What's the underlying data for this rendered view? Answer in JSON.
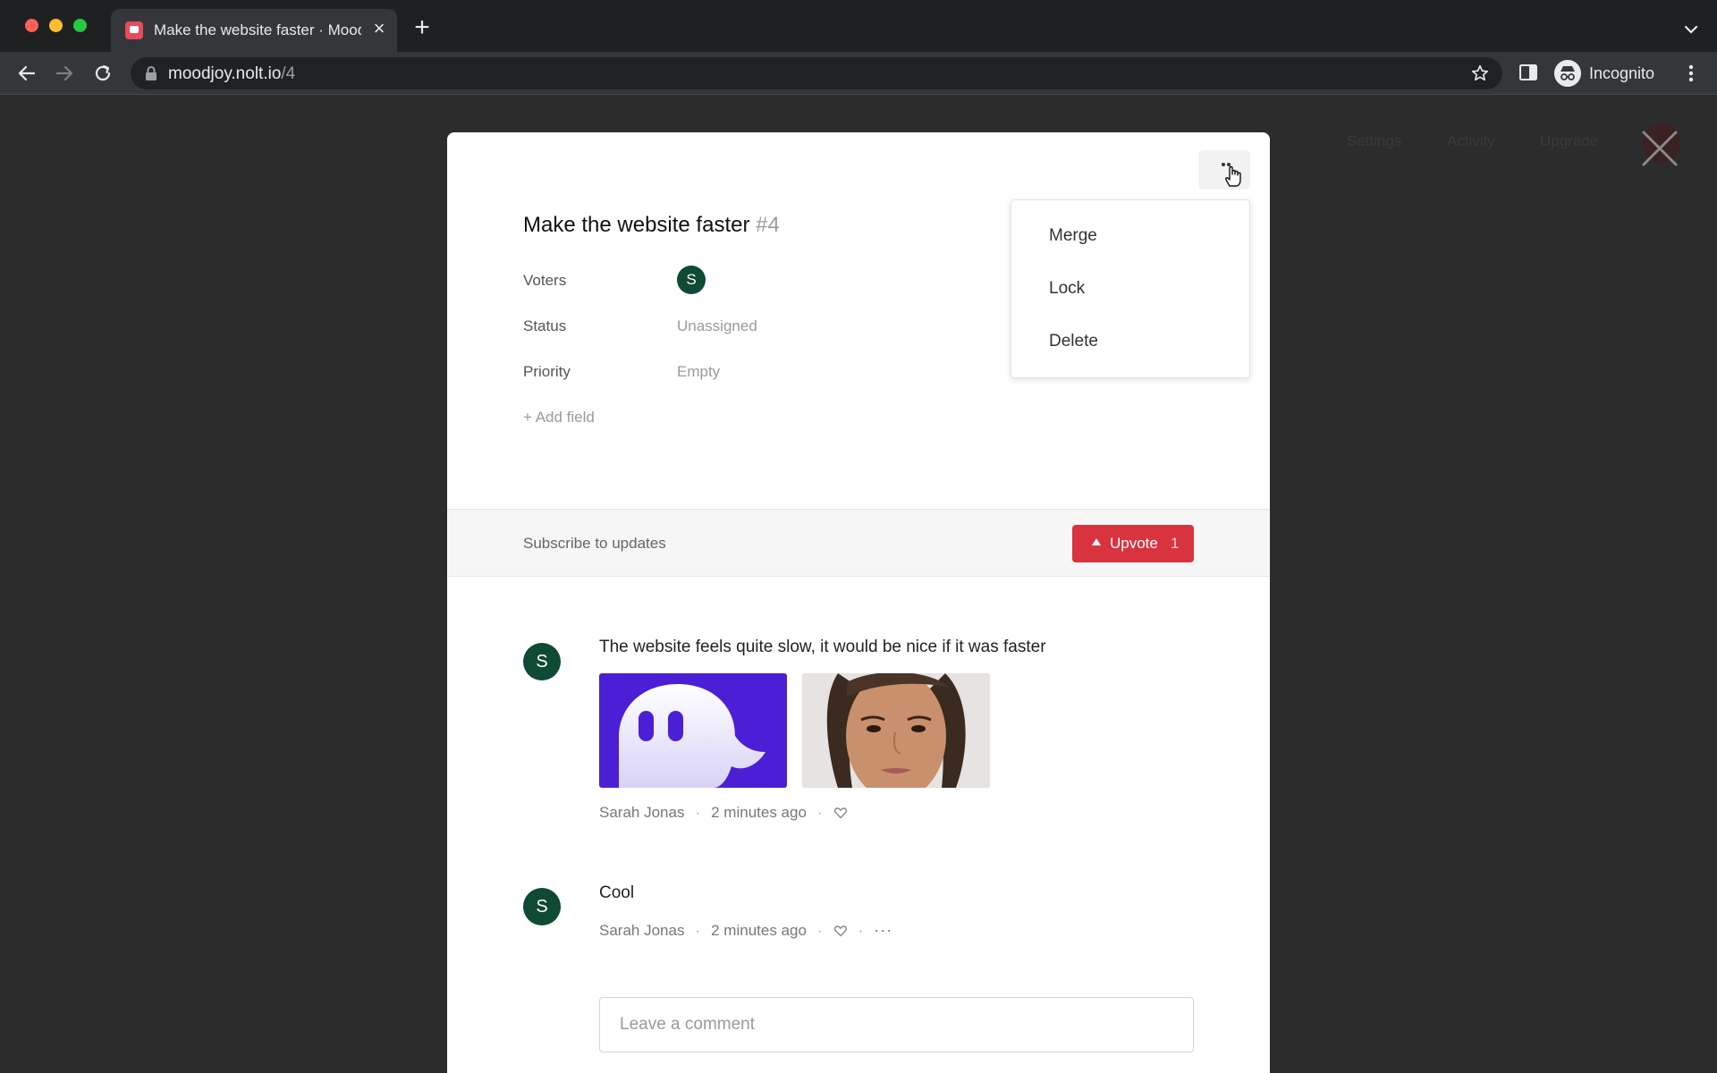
{
  "browser": {
    "tab_title": "Make the website faster · Moodjoy",
    "new_tab": "+",
    "tab_close": "×",
    "url_host": "moodjoy.nolt.io",
    "url_path": "/4",
    "profile_label": "Incognito"
  },
  "background_nav": {
    "settings": "Settings",
    "activity": "Activity",
    "upgrade": "Upgrade"
  },
  "post": {
    "title": "Make the website faster",
    "number": "#4",
    "fields": {
      "voters_label": "Voters",
      "voter_initial": "S",
      "status_label": "Status",
      "status_value": "Unassigned",
      "priority_label": "Priority",
      "priority_value": "Empty",
      "add_field": "+ Add field"
    }
  },
  "menu": {
    "items": [
      "Merge",
      "Lock",
      "Delete"
    ]
  },
  "subscribe": {
    "label": "Subscribe to updates",
    "upvote_label": "Upvote",
    "upvote_count": "1"
  },
  "comments": [
    {
      "initial": "S",
      "text": "The website feels quite slow, it would be nice if it was faster",
      "author": "Sarah Jonas",
      "time": "2 minutes ago",
      "attachments": [
        "app-logo-image",
        "portrait-photo"
      ]
    },
    {
      "initial": "S",
      "text": "Cool",
      "author": "Sarah Jonas",
      "time": "2 minutes ago",
      "more": "···"
    }
  ],
  "composer": {
    "placeholder": "Leave a comment"
  },
  "colors": {
    "upvote": "#d9333f",
    "avatar": "#0f4a33",
    "logo_bg": "#4b1fd6"
  }
}
